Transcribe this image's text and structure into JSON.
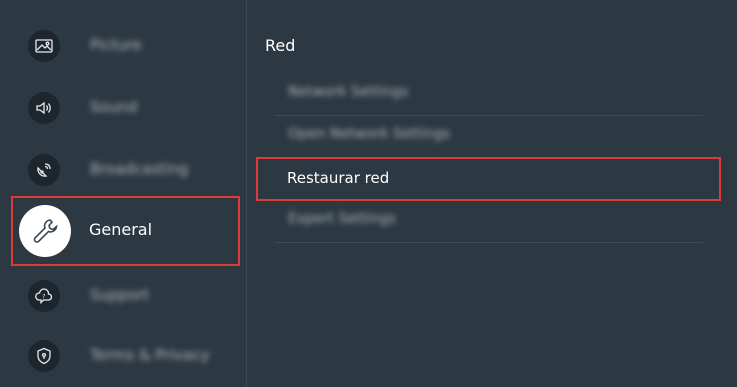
{
  "sidebar": {
    "items": [
      {
        "label": "Picture",
        "icon": "picture-icon"
      },
      {
        "label": "Sound",
        "icon": "speaker-icon"
      },
      {
        "label": "Broadcasting",
        "icon": "satellite-dish-icon"
      },
      {
        "label": "General",
        "icon": "wrench-icon"
      },
      {
        "label": "Support",
        "icon": "support-cloud-icon"
      },
      {
        "label": "Terms & Privacy",
        "icon": "shield-icon"
      }
    ]
  },
  "main": {
    "title": "Red",
    "items": [
      {
        "label": "Network Settings"
      },
      {
        "label": "Open Network Settings"
      },
      {
        "label": "Restaurar red"
      },
      {
        "label": "Expert Settings"
      }
    ]
  },
  "colors": {
    "background": "#2d3942",
    "highlight_border": "#e0383b",
    "icon_circle": "#1e262d"
  }
}
